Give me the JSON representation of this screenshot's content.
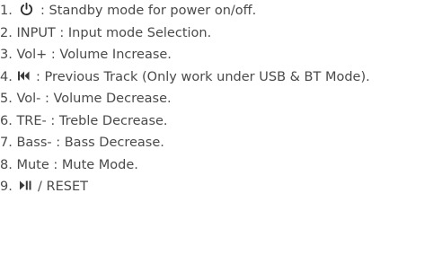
{
  "items": [
    {
      "num": "1.",
      "icon": "power-icon",
      "text": " : Standby mode for power on/off."
    },
    {
      "num": "2.",
      "text": " INPUT : Input mode Selection."
    },
    {
      "num": "3.",
      "text": " Vol+ : Volume Increase."
    },
    {
      "num": "4.",
      "icon": "previous-track-icon",
      "text": " : Previous Track (Only work under USB & BT Mode)."
    },
    {
      "num": "5.",
      "text": " Vol- : Volume Decrease."
    },
    {
      "num": "6.",
      "text": " TRE- : Treble Decrease."
    },
    {
      "num": "7.",
      "text": " Bass- : Bass Decrease."
    },
    {
      "num": "8.",
      "text": " Mute : Mute Mode."
    },
    {
      "num": "9.",
      "icon": "play-pause-icon",
      "text": " / RESET"
    }
  ],
  "colors": {
    "text": "#4a4a4a"
  }
}
